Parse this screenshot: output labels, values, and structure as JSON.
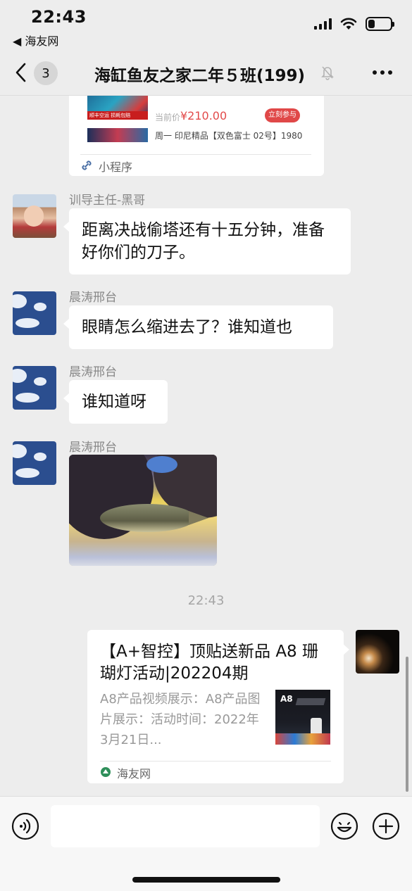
{
  "status_bar": {
    "time": "22:43",
    "back_app": "◀ 海友网",
    "battery_level": 0.3
  },
  "nav": {
    "unread_count": "3",
    "title": "海缸鱼友之家二年５班(199)"
  },
  "mini_program_card": {
    "thumb_label": "顺丰空运 损耗包赔",
    "price_label": "当前价",
    "price": "¥210.00",
    "join_button": "立刻参与",
    "item2": "周一 印尼精品【双色富士 02号】1980",
    "source": "小程序"
  },
  "messages": [
    {
      "sender": "训导主任-黑哥",
      "text": "距离决战偷塔还有十五分钟，准备好你们的刀子。"
    },
    {
      "sender": "晨涛邢台",
      "text": "眼睛怎么缩进去了？谁知道也"
    },
    {
      "sender": "晨涛邢台",
      "text": "谁知道呀"
    },
    {
      "sender": "晨涛邢台",
      "image": "fish-photo"
    }
  ],
  "time_separator": "22:43",
  "article_card": {
    "title": "【A+智控】顶贴送新品 A8 珊 瑚灯活动|202204期",
    "description": "A8产品视频展示：A8产品图片展示：活动时间：2022年3月21日...",
    "thumb_text": "A8",
    "source": "海友网"
  },
  "input_bar": {
    "voice_icon": "voice-icon",
    "emoji_icon": "emoji-icon",
    "plus_icon": "plus-icon"
  }
}
